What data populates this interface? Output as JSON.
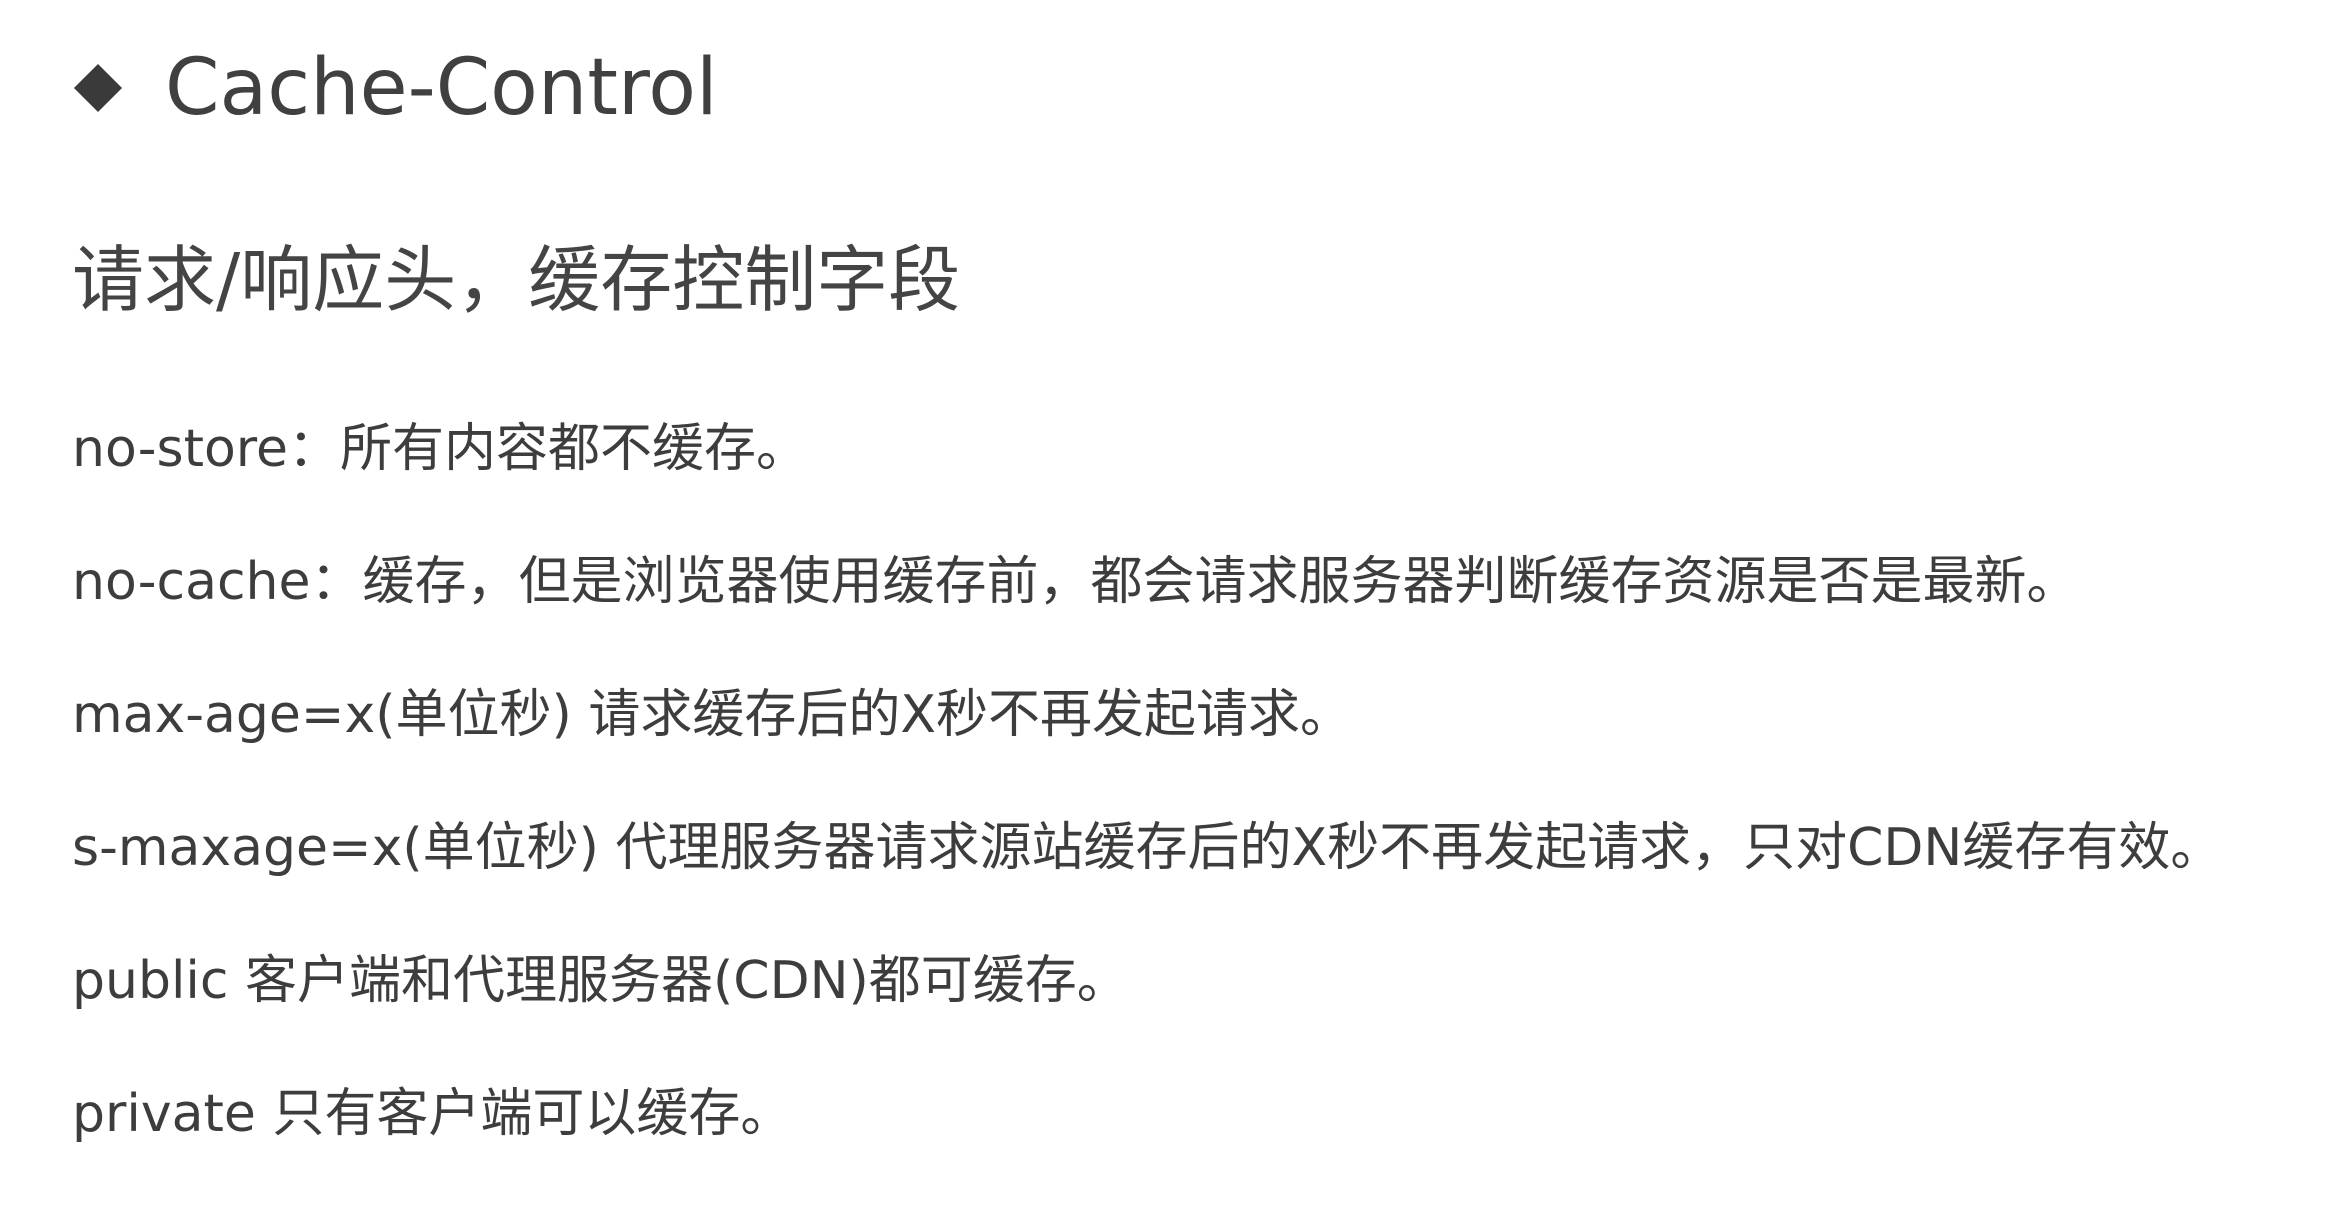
{
  "title": {
    "text": "Cache-Control"
  },
  "subtitle": "请求/响应头，缓存控制字段",
  "lines": [
    "no-store：所有内容都不缓存。",
    "no-cache：缓存，但是浏览器使用缓存前，都会请求服务器判断缓存资源是否是最新。",
    "max-age=x(单位秒) 请求缓存后的X秒不再发起请求。",
    "s-maxage=x(单位秒) 代理服务器请求源站缓存后的X秒不再发起请求，只对CDN缓存有效。",
    "public 客户端和代理服务器(CDN)都可缓存。",
    "private 只有客户端可以缓存。"
  ]
}
